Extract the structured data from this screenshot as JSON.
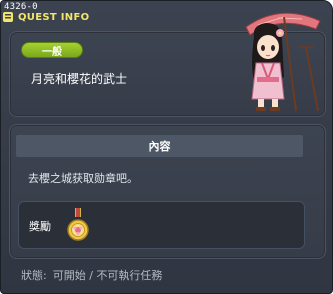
{
  "window": {
    "quest_id": "4326-0",
    "title": "QUEST INFO"
  },
  "quest": {
    "badge": "一般",
    "name": "月亮和櫻花的武士"
  },
  "content": {
    "header": "內容",
    "description": "去櫻之城获取勋章吧。"
  },
  "reward": {
    "label": "獎勵",
    "item_icon": "medal-icon"
  },
  "status": {
    "label": "狀態:",
    "value": "可開始 / 不可執行任務"
  },
  "colors": {
    "window_bg": "#363c48",
    "title_text": "#f3e46a",
    "badge_green": "#8dbd24"
  },
  "icons": [
    "quest-info-icon",
    "medal-icon",
    "npc-portrait"
  ]
}
